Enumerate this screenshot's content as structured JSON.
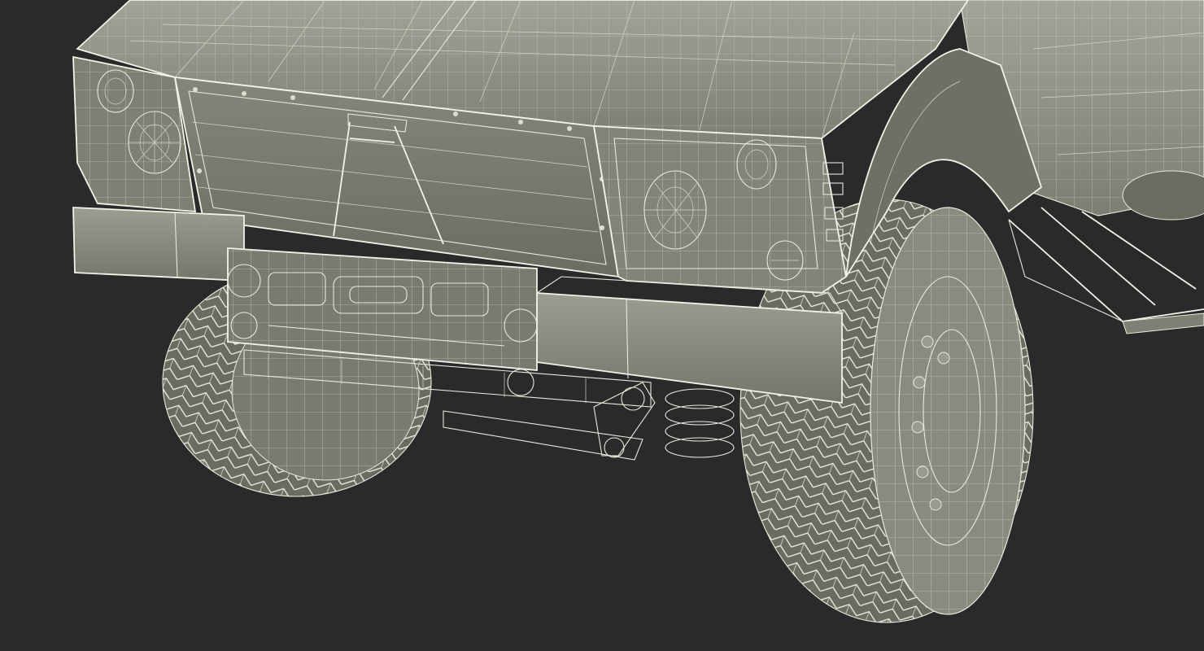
{
  "scene": {
    "subject": "",
    "background_color": "#2a2a2a",
    "surface_color": "#8e8e82",
    "surface_shadow_color": "#5e5e55",
    "wire_color": "#e8e8dc"
  }
}
